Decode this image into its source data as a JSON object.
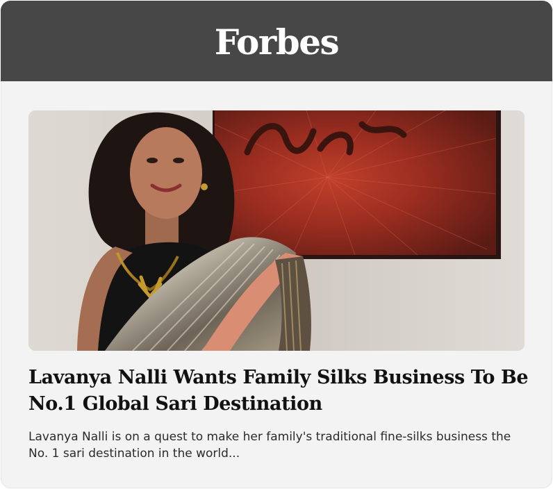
{
  "header": {
    "brand": "Forbes",
    "background_color": "#474747"
  },
  "article": {
    "image_alt": "Lavanya Nalli wearing a silk sari in front of artwork",
    "title": "Lavanya Nalli Wants Family Silks Business To Be No.1 Global Sari Destination",
    "summary": "Lavanya Nalli is on a quest to make her family's traditional fine-silks business the No. 1 sari destination in the world..."
  },
  "colors": {
    "card_background": "#f3f3f3",
    "title_text": "#111111",
    "summary_text": "#2a2a2a"
  }
}
